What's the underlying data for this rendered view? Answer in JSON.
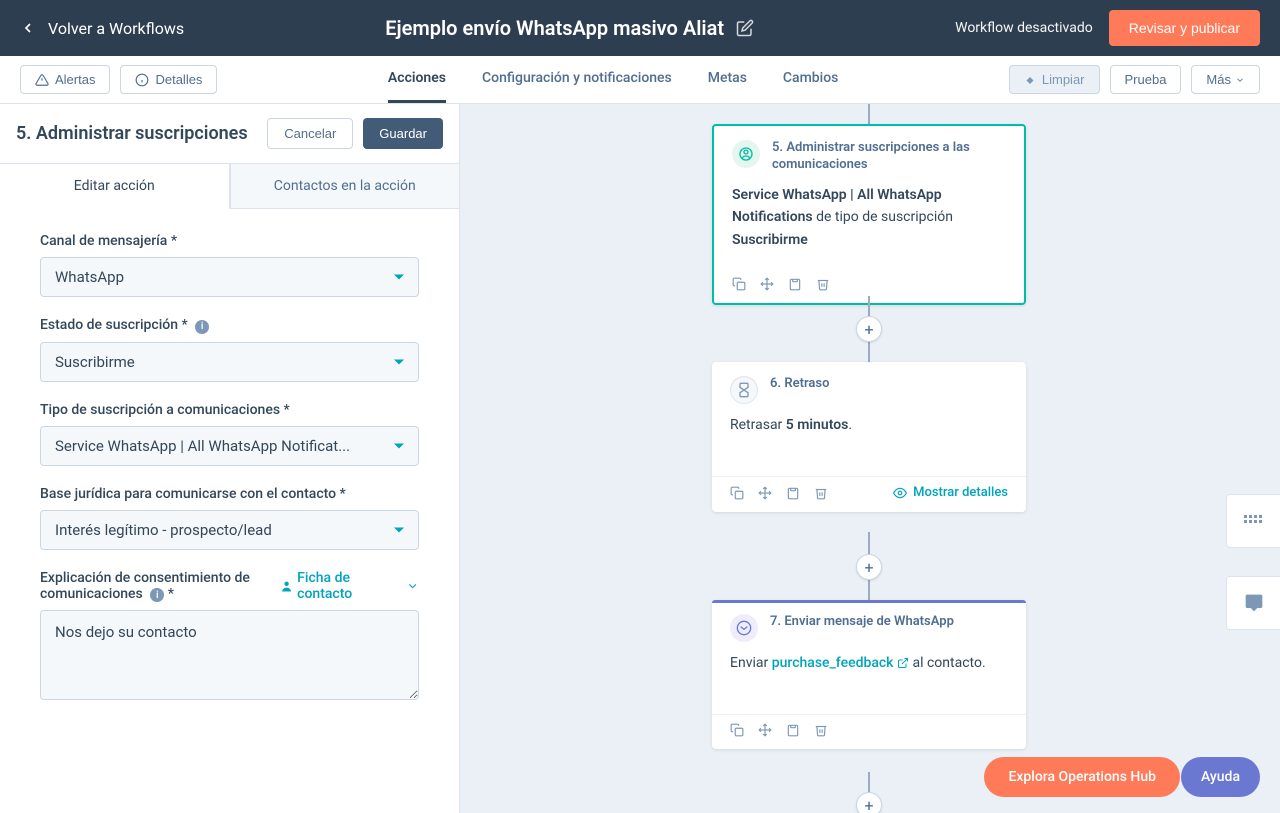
{
  "header": {
    "back": "Volver a Workflows",
    "title": "Ejemplo envío WhatsApp masivo Aliat",
    "status": "Workflow desactivado",
    "publish": "Revisar y publicar"
  },
  "subheader": {
    "alerts": "Alertas",
    "details": "Detalles",
    "tabs": {
      "actions": "Acciones",
      "config": "Configuración y notificaciones",
      "goals": "Metas",
      "changes": "Cambios"
    },
    "clean": "Limpiar",
    "test": "Prueba",
    "more": "Más"
  },
  "panel": {
    "title": "5. Administrar suscripciones",
    "cancel": "Cancelar",
    "save": "Guardar",
    "tab_edit": "Editar acción",
    "tab_contacts": "Contactos en la acción"
  },
  "form": {
    "channel": {
      "label": "Canal de mensajería *",
      "value": "WhatsApp"
    },
    "state": {
      "label": "Estado de suscripción *",
      "value": "Suscribirme"
    },
    "type": {
      "label": "Tipo de suscripción a comunicaciones *",
      "value": "Service WhatsApp | All WhatsApp Notificat..."
    },
    "basis": {
      "label": "Base jurídica para comunicarse con el contacto *",
      "value": "Interés legítimo - prospecto/lead"
    },
    "explain": {
      "label": "Explicación de consentimiento de comunicaciones",
      "required": "*",
      "chip": "Ficha de contacto",
      "value": "Nos dejo su contacto"
    }
  },
  "nodes": {
    "n5": {
      "title": "5. Administrar suscripciones a las comunicaciones",
      "line1": "Service WhatsApp | All WhatsApp Notifications",
      "line1_suffix": " de tipo de suscripción",
      "line2": "Suscribirme"
    },
    "n6": {
      "title": "6. Retraso",
      "prefix": "Retrasar ",
      "bold": "5 minutos",
      "suffix": "."
    },
    "n7": {
      "title": "7. Enviar mensaje de WhatsApp",
      "prefix": "Enviar ",
      "link": "purchase_feedback",
      "suffix": " al contacto."
    },
    "show_details": "Mostrar detalles"
  },
  "floating": {
    "explore": "Explora Operations Hub",
    "help": "Ayuda"
  }
}
